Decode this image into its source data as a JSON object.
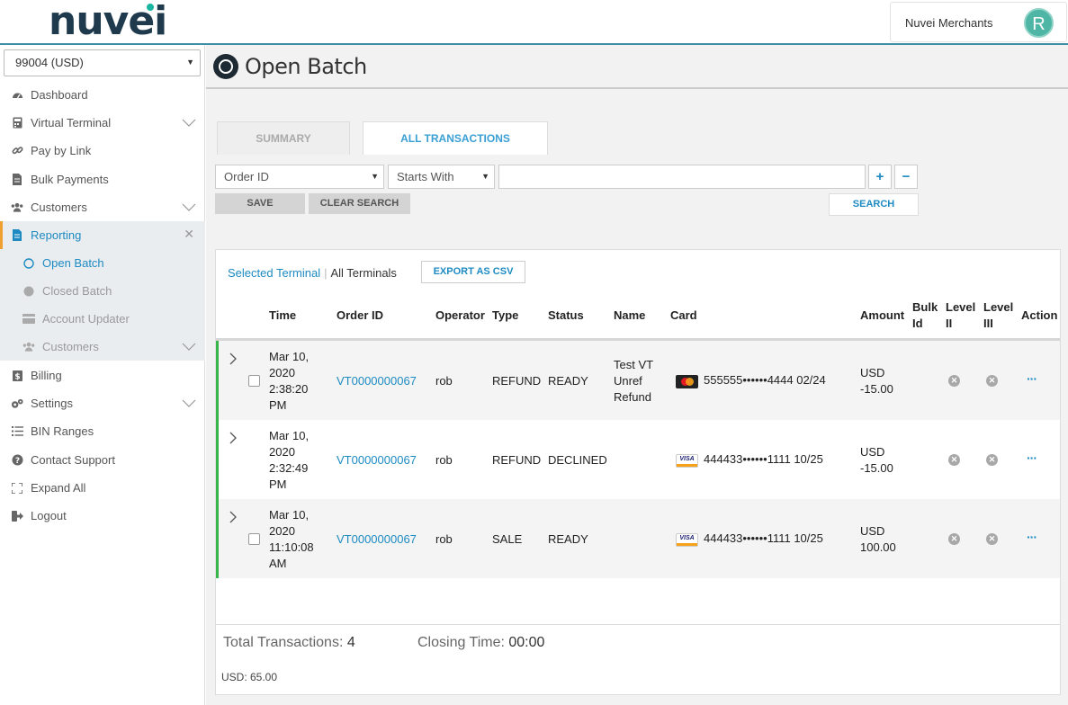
{
  "header": {
    "logo_text": "nuvei",
    "account_name": "Nuvei Merchants",
    "avatar_letter": "R"
  },
  "sidebar": {
    "terminal": "99004 (USD)",
    "items": [
      {
        "label": "Dashboard"
      },
      {
        "label": "Virtual Terminal"
      },
      {
        "label": "Pay by Link"
      },
      {
        "label": "Bulk Payments"
      },
      {
        "label": "Customers"
      },
      {
        "label": "Reporting"
      },
      {
        "label": "Open Batch"
      },
      {
        "label": "Closed Batch"
      },
      {
        "label": "Account Updater"
      },
      {
        "label": "Customers"
      },
      {
        "label": "Billing"
      },
      {
        "label": "Settings"
      },
      {
        "label": "BIN Ranges"
      },
      {
        "label": "Contact Support"
      },
      {
        "label": "Expand All"
      },
      {
        "label": "Logout"
      }
    ]
  },
  "page": {
    "title": "Open Batch",
    "tabs": [
      "SUMMARY",
      "ALL TRANSACTIONS"
    ]
  },
  "filters": {
    "field": "Order ID",
    "operator": "Starts With",
    "value": "",
    "plus": "+",
    "minus": "−",
    "save_label": "SAVE",
    "clear_label": "CLEAR SEARCH",
    "search_label": "SEARCH"
  },
  "panel": {
    "selected_terminal": "Selected Terminal",
    "all_terminals": "All Terminals",
    "export_label": "EXPORT AS CSV"
  },
  "table": {
    "columns": {
      "time": "Time",
      "order_id": "Order ID",
      "operator": "Operator",
      "type": "Type",
      "status": "Status",
      "name": "Name",
      "card": "Card",
      "amount": "Amount",
      "bulk_id": "Bulk Id",
      "level2": "Level II",
      "level3": "Level III",
      "action": "Action"
    },
    "rows": [
      {
        "time": "Mar 10, 2020 2:38:20 PM",
        "order_id": "VT0000000067",
        "operator": "rob",
        "type": "REFUND",
        "status": "READY",
        "name": "Test VT Unref Refund",
        "card_brand": "mastercard",
        "card": "555555••••••4444 02/24",
        "amount": "USD -15.00"
      },
      {
        "time": "Mar 10, 2020 2:32:49 PM",
        "order_id": "VT0000000067",
        "operator": "rob",
        "type": "REFUND",
        "status": "DECLINED",
        "name": "",
        "card_brand": "visa",
        "card": "444433••••••1111 10/25",
        "amount": "USD -15.00"
      },
      {
        "time": "Mar 10, 2020 11:10:08 AM",
        "order_id": "VT0000000067",
        "operator": "rob",
        "type": "SALE",
        "status": "READY",
        "name": "",
        "card_brand": "visa",
        "card": "444433••••••1111 10/25",
        "amount": "USD 100.00"
      }
    ]
  },
  "footer": {
    "total_label": "Total Transactions:",
    "total_value": "4",
    "closing_label": "Closing Time:",
    "closing_value": "00:00",
    "usd_total": "USD: 65.00"
  },
  "colors": {
    "accent": "#1d8bc2",
    "brand_teal": "#4fb6a5",
    "row_marker": "#39b54a",
    "active_marker": "#f0a030"
  }
}
